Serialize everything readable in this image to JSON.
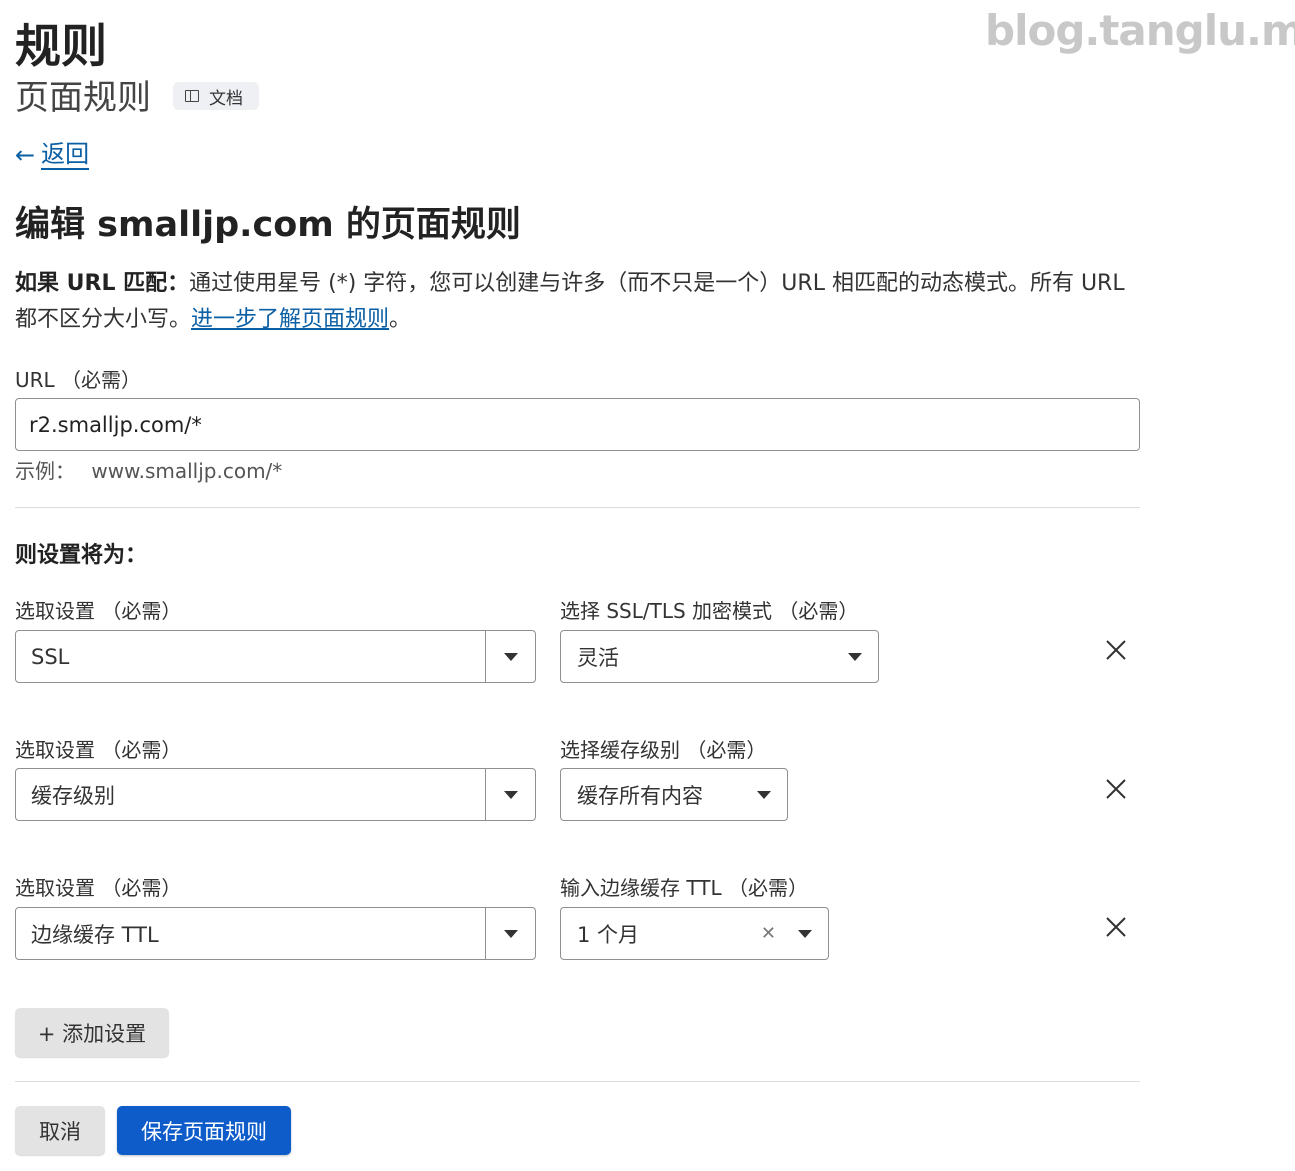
{
  "watermark": "blog.tanglu.me",
  "header": {
    "title": "规则",
    "subtitle": "页面规则",
    "docs_label": "文档"
  },
  "back_label": "返回",
  "edit_title": "编辑 smalljp.com 的页面规则",
  "description": {
    "bold_prefix": "如果 URL 匹配：",
    "text": "通过使用星号 (*) 字符，您可以创建与许多（而不只是一个）URL 相匹配的动态模式。所有 URL 都不区分大小写。",
    "link_text": "进一步了解页面规则",
    "suffix": "。"
  },
  "url_field": {
    "label": "URL （必需）",
    "value": "r2.smalljp.com/*",
    "example_label": "示例：",
    "example_value": "www.smalljp.com/*"
  },
  "settings_title": "则设置将为：",
  "settings": [
    {
      "pick_label": "选取设置 （必需）",
      "pick_value": "SSL",
      "value_label": "选择 SSL/TLS 加密模式 （必需）",
      "value": "灵活"
    },
    {
      "pick_label": "选取设置 （必需）",
      "pick_value": "缓存级别",
      "value_label": "选择缓存级别 （必需）",
      "value": "缓存所有内容"
    },
    {
      "pick_label": "选取设置 （必需）",
      "pick_value": "边缘缓存 TTL",
      "value_label": "输入边缘缓存 TTL （必需）",
      "value": "1 个月"
    }
  ],
  "add_setting_label": "+ 添加设置",
  "cancel_label": "取消",
  "save_label": "保存页面规则"
}
